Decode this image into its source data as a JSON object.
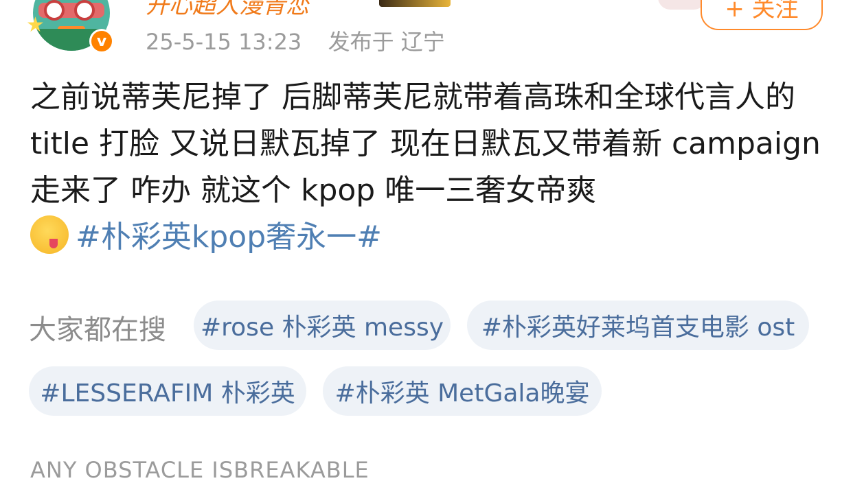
{
  "user": {
    "name": "开心超人漫青恋",
    "verified_mark": "v"
  },
  "meta": {
    "timestamp": "25-5-15 13:23",
    "location": "发布于 辽宁"
  },
  "follow_button": {
    "label": "+ 关注"
  },
  "post": {
    "text": "之前说蒂芙尼掉了 后脚蒂芙尼就带着高珠和全球代言人的 title 打脸 又说日默瓦掉了 现在日默瓦又带着新 campaign 走来了 咋办 就这个 kpop 唯一三奢女帝爽",
    "emoji": "yum-face",
    "hashtag": "#朴彩英kpop奢永一#"
  },
  "trending": {
    "label": "大家都在搜",
    "chips": [
      "#rose 朴彩英 messy",
      "#朴彩英好莱坞首支电影 ost",
      "#LESSERAFIM 朴彩英",
      "#朴彩英 MetGala晚宴"
    ]
  },
  "signature": "ANY OBSTACLE ISBREAKABLE",
  "colors": {
    "accent": "#ff8a2b",
    "hashtag": "#4f7fb3",
    "chip_bg": "#eef2f7",
    "meta": "#9b9b9b"
  }
}
